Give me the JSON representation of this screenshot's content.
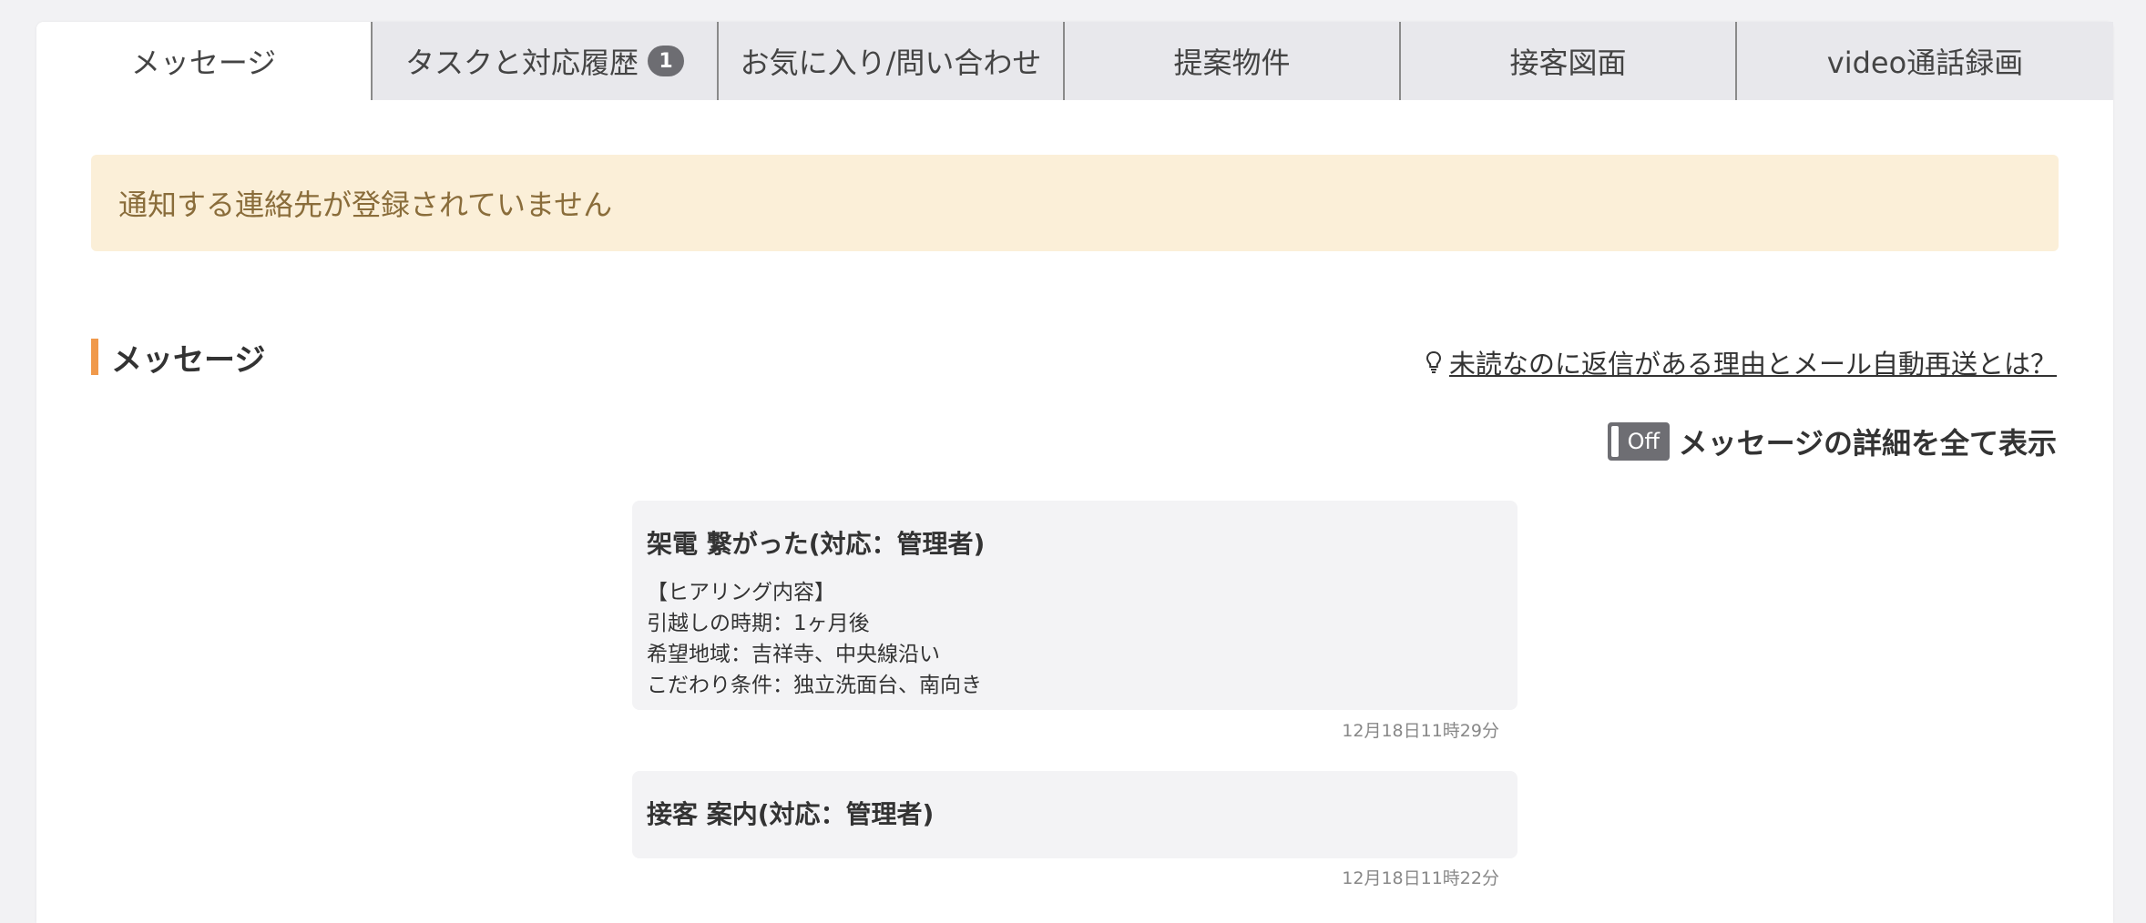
{
  "tabs": [
    {
      "label": "メッセージ",
      "active": true
    },
    {
      "label": "タスクと対応履歴",
      "badge": "1"
    },
    {
      "label": "お気に入り/問い合わせ"
    },
    {
      "label": "提案物件"
    },
    {
      "label": "接客図面"
    },
    {
      "label": "video通話録画"
    }
  ],
  "alert": {
    "text": "通知する連絡先が登録されていません"
  },
  "section": {
    "title": "メッセージ",
    "help_link": "未読なのに返信がある理由とメール自動再送とは？",
    "help_icon": "lightbulb-icon",
    "toggle": {
      "state": "Off",
      "label": "メッセージの詳細を全て表示"
    }
  },
  "messages": [
    {
      "title": "架電 繋がった(対応：管理者)",
      "body": [
        "【ヒアリング内容】",
        "引越しの時期：1ヶ月後",
        "希望地域：吉祥寺、中央線沿い",
        "こだわり条件：独立洗面台、南向き"
      ],
      "time": "12月18日11時29分"
    },
    {
      "title": "接客 案内(対応：管理者)",
      "time": "12月18日11時22分"
    }
  ],
  "colors": {
    "accent": "#f0994b",
    "alert_bg": "#fbefd8",
    "alert_text": "#8a6d3b",
    "toggle_bg": "#6e6e73"
  }
}
